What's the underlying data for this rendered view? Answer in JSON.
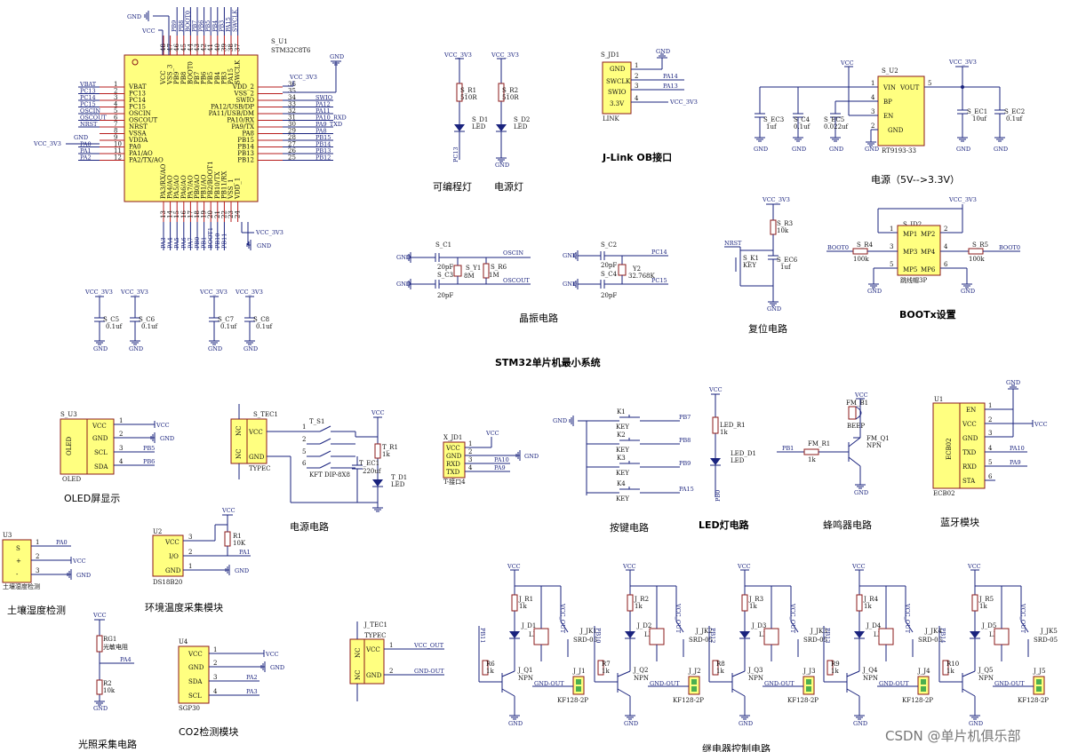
{
  "mcu": {
    "ref": "S_U1",
    "part": "STM32C8T6",
    "left_pins": [
      {
        "num": "1",
        "name": "VBAT",
        "net": "VBAT"
      },
      {
        "num": "2",
        "name": "PC13",
        "net": "PC13"
      },
      {
        "num": "3",
        "name": "PC14",
        "net": "PC14"
      },
      {
        "num": "4",
        "name": "PC15",
        "net": "PC15"
      },
      {
        "num": "5",
        "name": "OSCIN",
        "net": "OSCIN"
      },
      {
        "num": "6",
        "name": "OSCOUT",
        "net": "OSCOUT"
      },
      {
        "num": "7",
        "name": "NRST",
        "net": "NRST"
      },
      {
        "num": "8",
        "name": "VSSA",
        "net": "GND"
      },
      {
        "num": "9",
        "name": "VDDA",
        "net": "VCC_3V3"
      },
      {
        "num": "10",
        "name": "PA0",
        "net": "PA0"
      },
      {
        "num": "11",
        "name": "PA1/AO",
        "net": "PA1"
      },
      {
        "num": "12",
        "name": "PA2/TX/AO",
        "net": "PA2"
      }
    ],
    "right_pins": [
      {
        "num": "36",
        "name": "VDD_2",
        "net": "VCC_3V3"
      },
      {
        "num": "35",
        "name": "VSS_2",
        "net": ""
      },
      {
        "num": "34",
        "name": "SWIO",
        "net": "SWIO"
      },
      {
        "num": "33",
        "name": "PA12/USB/DP",
        "net": "PA12"
      },
      {
        "num": "32",
        "name": "PA11/USB/DM",
        "net": "PA11"
      },
      {
        "num": "31",
        "name": "PA10/RX",
        "net": "PA10_RXD"
      },
      {
        "num": "30",
        "name": "PA9/TX",
        "net": "PA9_TXD"
      },
      {
        "num": "29",
        "name": "PA8",
        "net": "PA8"
      },
      {
        "num": "28",
        "name": "PB15",
        "net": "PB15"
      },
      {
        "num": "27",
        "name": "PB14",
        "net": "PB14"
      },
      {
        "num": "26",
        "name": "PB13",
        "net": "PB13"
      },
      {
        "num": "25",
        "name": "PB12",
        "net": "PB12"
      }
    ],
    "top_pins": [
      {
        "num": "48",
        "name": "VCC"
      },
      {
        "num": "47",
        "name": "VSS_3"
      },
      {
        "num": "46",
        "name": "PB9"
      },
      {
        "num": "45",
        "name": "PB8"
      },
      {
        "num": "44",
        "name": "BOOT0"
      },
      {
        "num": "43",
        "name": "PB7"
      },
      {
        "num": "42",
        "name": "PB6"
      },
      {
        "num": "41",
        "name": "PB5"
      },
      {
        "num": "40",
        "name": "PB4"
      },
      {
        "num": "39",
        "name": "PB3"
      },
      {
        "num": "38",
        "name": "PA15"
      },
      {
        "num": "37",
        "name": "SWCLK"
      }
    ],
    "top_nets": [
      "GND",
      "VCC",
      "PB9",
      "PB8",
      "BOOT0",
      "PB7",
      "PB6",
      "PB5",
      "PB4",
      "PB3",
      "PA15",
      "SWCLK"
    ],
    "bottom_pins": [
      {
        "num": "13",
        "name": "PA3/RX/AO"
      },
      {
        "num": "14",
        "name": "PA4/AO"
      },
      {
        "num": "15",
        "name": "PA5/AO"
      },
      {
        "num": "16",
        "name": "PA6/AO"
      },
      {
        "num": "17",
        "name": "PA7/AO"
      },
      {
        "num": "18",
        "name": "PB0/AO"
      },
      {
        "num": "19",
        "name": "PB1/AO"
      },
      {
        "num": "20",
        "name": "PB2/BOOT1"
      },
      {
        "num": "21",
        "name": "PB10/TX"
      },
      {
        "num": "22",
        "name": "PB11/RX"
      },
      {
        "num": "23",
        "name": "VSS_1"
      },
      {
        "num": "24",
        "name": "VDD_1"
      }
    ],
    "bottom_nets": [
      "PA3",
      "PA4",
      "PA5",
      "PA6",
      "PA7",
      "PB0",
      "PB1",
      "BOOT1",
      "PB10",
      "PB11",
      "",
      ""
    ]
  },
  "nets": {
    "vcc": "VCC",
    "vcc33": "VCC_3V3",
    "gnd": "GND"
  },
  "leds_top": {
    "r1": "S_R1",
    "r1v": "510R",
    "d1": "S_D1",
    "d1v": "LED",
    "d1net": "PC13",
    "r2": "S_R2",
    "r2v": "510R",
    "d2": "S_D2",
    "d2v": "LED",
    "cap1": "可编程灯",
    "cap2": "电源灯"
  },
  "jlink": {
    "ref": "S_JD1",
    "pins": [
      "GND",
      "SWCLK",
      "SWIO",
      "3.3V"
    ],
    "nums": [
      "1",
      "2",
      "3",
      "4"
    ],
    "nets": [
      "GND",
      "PA14",
      "PA13",
      "VCC_3V3"
    ],
    "footer": "LINK",
    "caption": "J-Link OB接口"
  },
  "power": {
    "ref": "S_U2",
    "part": "RT9193-33",
    "pins_left": [
      "VIN",
      "BP",
      "EN"
    ],
    "pins_right": [
      "VOUT"
    ],
    "pin_bottom": "GND",
    "nums": [
      "1",
      "4",
      "3",
      "2",
      "5"
    ],
    "ec3": "S_EC3",
    "ec3v": "1uf",
    "c4": "S_C4",
    "c4v": "0.1uf",
    "c5": "S_EC5",
    "c5v": "0.022uf",
    "ec1": "S_EC1",
    "ec1v": "10uf",
    "ec2": "S_EC2",
    "ec2v": "0.1uf",
    "caption": "电源（5V-->3.3V）"
  },
  "crystal": {
    "c1": "S_C1",
    "c1v": "20pF",
    "c3": "S_C3",
    "c3v": "20pF",
    "y1": "S_Y1",
    "y1v": "8M",
    "r6": "S_R6",
    "r6v": "1M",
    "osc_in": "OSCIN",
    "osc_out": "OSCOUT",
    "c2": "S_C2",
    "c2v": "20pF",
    "c4b": "S_C4",
    "c4bv": "20pF",
    "y2": "Y2",
    "y2v": "32.768K",
    "pc14": "PC14",
    "pc15": "PC15",
    "caption": "晶振电路"
  },
  "reset": {
    "r3": "S_R3",
    "r3v": "10k",
    "k1": "S_K1",
    "k1v": "KEY",
    "c6": "S_EC6",
    "c6v": "1uf",
    "nrst": "NRST",
    "caption": "复位电路"
  },
  "boot": {
    "ref": "S_JD2",
    "pins": [
      "MP1",
      "MP2",
      "MP3",
      "MP4",
      "MP5",
      "MP6"
    ],
    "nums": [
      "1",
      "2",
      "3",
      "4",
      "5",
      "6"
    ],
    "r4": "S_R4",
    "r4v": "100k",
    "r5": "S_R5",
    "r5v": "100k",
    "net0": "BOOT0",
    "net1": "BOOT0",
    "footer": "跳线帽3P",
    "caption": "BOOTx设置"
  },
  "decoupling": [
    {
      "ref": "S_C5",
      "val": "0.1uf"
    },
    {
      "ref": "S_C6",
      "val": "0.1uf"
    },
    {
      "ref": "S_C7",
      "val": "0.1uf"
    },
    {
      "ref": "S_C8",
      "val": "0.1uf"
    }
  ],
  "system_caption": "STM32单片机最小系统",
  "oled": {
    "ref": "S_U3",
    "part": "OLED",
    "pins": [
      "VCC",
      "GND",
      "SCL",
      "SDA"
    ],
    "nums": [
      "1",
      "2",
      "3",
      "4"
    ],
    "nets": [
      "VCC",
      "GND",
      "PB5",
      "PB6"
    ],
    "footer": "OLED",
    "caption": "OLED屏显示"
  },
  "power2": {
    "tec1": "S_TEC1",
    "nc": "NC",
    "vcc": "VCC",
    "gnd": "GND",
    "typec": "TYPEC",
    "s1": "T_S1",
    "kft": "KFT DIP-8X8",
    "tr1": "T_R1",
    "tr1v": "1k",
    "tec": "T_EC1",
    "tecv": "220uf",
    "td1": "T_D1",
    "td1v": "LED",
    "caption": "电源电路",
    "pinnums": [
      "1",
      "2",
      "3",
      "4",
      "5",
      "6"
    ]
  },
  "uart": {
    "ref": "X_JD1",
    "pins": [
      "VCC",
      "GND",
      "RXD",
      "TXD"
    ],
    "nums": [
      "1",
      "2",
      "3",
      "4"
    ],
    "nets": [
      "VCC",
      "GND",
      "PA10",
      "PA9"
    ],
    "footer": "T-接口4"
  },
  "keys": {
    "refs": [
      "K1",
      "K2",
      "K3",
      "K4"
    ],
    "val": "KEY",
    "nets": [
      "PB7",
      "PB8",
      "PB9",
      "PA15"
    ],
    "caption": "按键电路"
  },
  "led_ckt": {
    "r": "LED_R1",
    "rv": "1k",
    "d": "LED_D1",
    "dv": "LED",
    "net": "PB0",
    "caption": "LED灯电路"
  },
  "buzzer": {
    "b": "FM_B1",
    "bv": "BEEP",
    "r": "FM_R1",
    "rv": "1k",
    "q": "FM_Q1",
    "qv": "NPN",
    "net": "PB1",
    "caption": "蜂鸣器电路"
  },
  "bt": {
    "ref": "U1",
    "part": "ECB02",
    "pins": [
      "EN",
      "VCC",
      "GND",
      "TXD",
      "RXD",
      "STA"
    ],
    "nums": [
      "1",
      "2",
      "3",
      "4",
      "5",
      "6"
    ],
    "nets": [
      "",
      "VCC",
      "",
      "PA10",
      "PA9",
      ""
    ],
    "footer": "ECB02",
    "caption": "蓝牙模块"
  },
  "soil": {
    "ref": "U3",
    "pins": [
      "S",
      "+",
      "-"
    ],
    "nums": [
      "1",
      "2",
      "3"
    ],
    "nets": [
      "PA0",
      "VCC",
      "GND"
    ],
    "footer": "土壤湿度检测",
    "caption": "土壤湿度检测"
  },
  "ds18b20": {
    "ref": "U2",
    "pins": [
      "VCC",
      "I/O",
      "GND"
    ],
    "nums": [
      "3",
      "2",
      "1"
    ],
    "r": "R1",
    "rv": "10K",
    "net": "PA1",
    "footer": "DS18B20",
    "caption": "环境温度采集模块"
  },
  "light": {
    "rg": "RG1",
    "rgv": "光敏电阻",
    "r": "R2",
    "rv": "10k",
    "net": "PA4",
    "caption": "光照采集电路"
  },
  "co2": {
    "ref": "U4",
    "pins": [
      "VCC",
      "GND",
      "SDA",
      "SCL"
    ],
    "nums": [
      "1",
      "2",
      "3",
      "4"
    ],
    "nets": [
      "VCC",
      "GND",
      "PA2",
      "PA3"
    ],
    "footer": "SGP30",
    "caption": "CO2检测模块"
  },
  "jtec": {
    "ref": "J_TEC1",
    "typec": "TYPEC",
    "nc": "NC",
    "pins": [
      "VCC",
      "GND"
    ],
    "nums": [
      "1",
      "2"
    ],
    "nets": [
      "VCC_OUT",
      "GND-OUT"
    ]
  },
  "relays": [
    {
      "r": "J_R1",
      "r2": "R6",
      "d": "J_D1",
      "q": "J_Q1",
      "jk": "J_JK1",
      "j": "J_J1",
      "net": "PB11"
    },
    {
      "r": "J_R2",
      "r2": "R7",
      "d": "J_D2",
      "q": "J_Q2",
      "jk": "J_JK2",
      "j": "J_J2",
      "net": "PB10"
    },
    {
      "r": "J_R3",
      "r2": "R8",
      "d": "J_D3",
      "q": "J_Q3",
      "jk": "J_JK3",
      "j": "J_J3",
      "net": "PB12"
    },
    {
      "r": "J_R4",
      "r2": "R9",
      "d": "J_D4",
      "q": "J_Q4",
      "jk": "J_JK4",
      "j": "J_J4",
      "net": "PB13"
    },
    {
      "r": "J_R5",
      "r2": "R10",
      "d": "J_D5",
      "q": "J_Q5",
      "jk": "J_JK5",
      "j": "J_J5",
      "net": "PB14"
    }
  ],
  "relay_common": {
    "rv": "1k",
    "led": "LED",
    "npn": "NPN",
    "srd": "SRD-05",
    "kf": "KF128-2P",
    "vccout": "VCC_OUT",
    "gndout": "GND-OUT",
    "caption": "继电器控制电路"
  },
  "watermark": "CSDN @单片机俱乐部"
}
